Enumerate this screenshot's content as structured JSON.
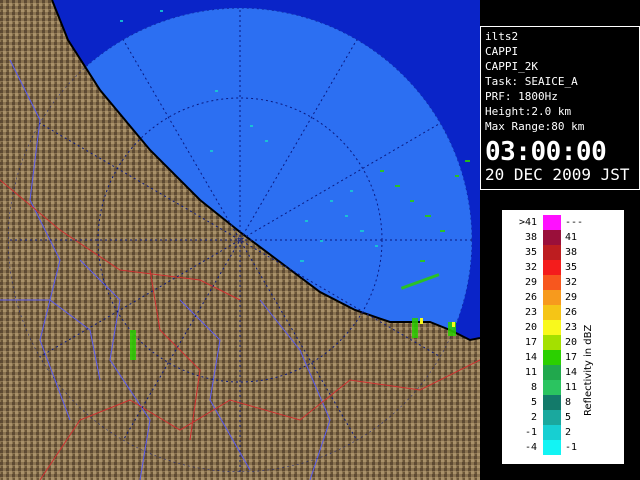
{
  "info": {
    "radar": "ilts2",
    "product": "CAPPI",
    "product_name": "CAPPI_2K",
    "task": "Task: SEAICE_A",
    "prf": "PRF: 1800Hz",
    "height": "Height:2.0 km",
    "max_range": "Max Range:80 km",
    "time": "03:00:00",
    "date": "20 DEC 2009 JST"
  },
  "legend": {
    "unit": "Reflectivity in dBZ",
    "rows": [
      {
        "low": ">41",
        "high": "---",
        "color": "#ff10ff"
      },
      {
        "low": "38",
        "high": "41",
        "color": "#9a0f3a"
      },
      {
        "low": "35",
        "high": "38",
        "color": "#bd1d20"
      },
      {
        "low": "32",
        "high": "35",
        "color": "#f41c1c"
      },
      {
        "low": "29",
        "high": "32",
        "color": "#f7571e"
      },
      {
        "low": "26",
        "high": "29",
        "color": "#f79a1d"
      },
      {
        "low": "23",
        "high": "26",
        "color": "#f5c516"
      },
      {
        "low": "20",
        "high": "23",
        "color": "#f9f91c"
      },
      {
        "low": "17",
        "high": "20",
        "color": "#a4e000"
      },
      {
        "low": "14",
        "high": "17",
        "color": "#2bd000"
      },
      {
        "low": "11",
        "high": "14",
        "color": "#21a84d"
      },
      {
        "low": "8",
        "high": "11",
        "color": "#2bc460"
      },
      {
        "low": "5",
        "high": "8",
        "color": "#137a6a"
      },
      {
        "low": "2",
        "high": "5",
        "color": "#1aa89e"
      },
      {
        "low": "-1",
        "high": "2",
        "color": "#17cfd2"
      },
      {
        "low": "-4",
        "high": "-1",
        "color": "#12f4f4"
      }
    ]
  }
}
